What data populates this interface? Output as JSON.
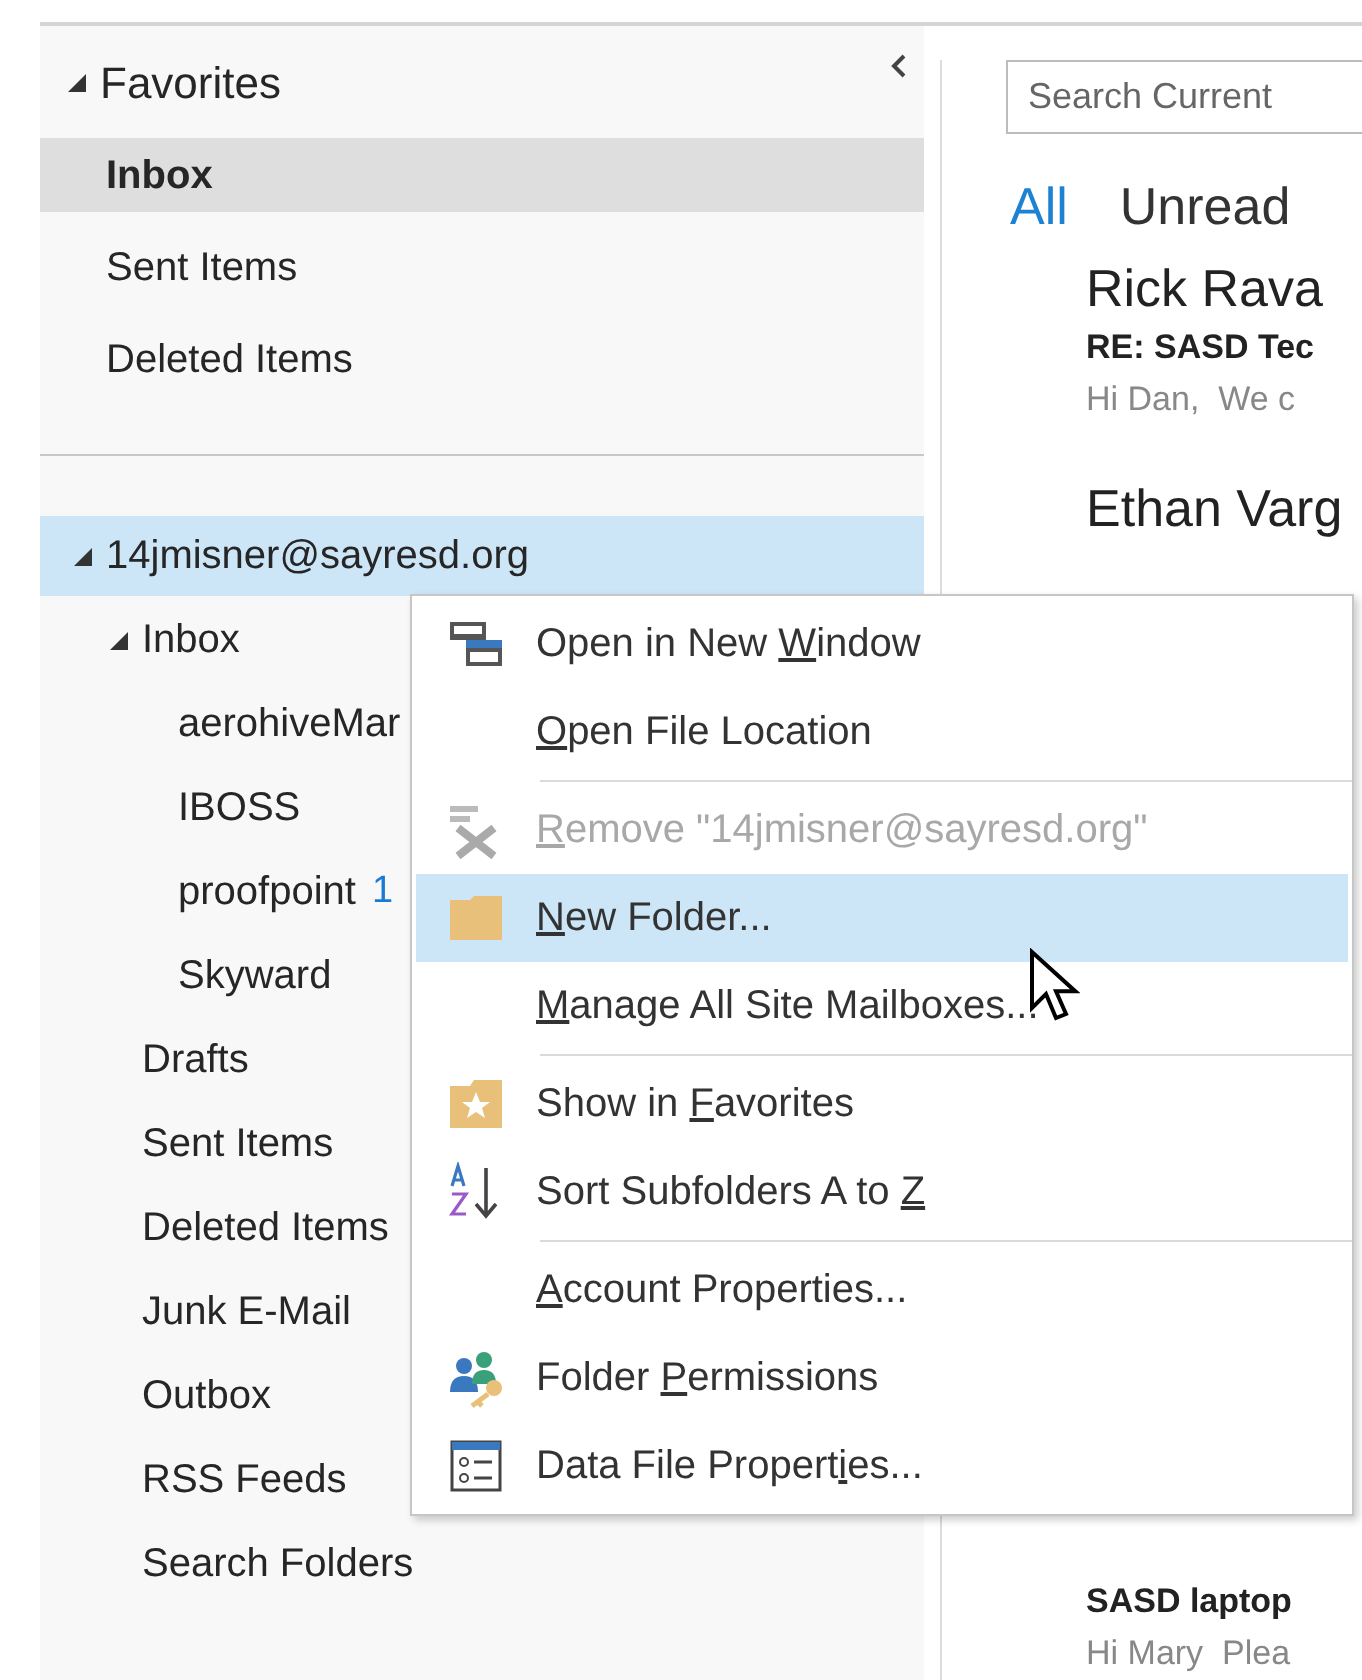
{
  "favorites": {
    "label": "Favorites",
    "expanded": true,
    "items": [
      {
        "label": "Inbox",
        "selected": true
      },
      {
        "label": "Sent Items",
        "selected": false
      },
      {
        "label": "Deleted Items",
        "selected": false
      }
    ]
  },
  "account": {
    "label": "14jmisner@sayresd.org",
    "expanded": true,
    "selected": true,
    "children": [
      {
        "label": "Inbox",
        "expanded": true,
        "selected": false,
        "children": [
          {
            "label": "aerohiveMar",
            "selected": false
          },
          {
            "label": "IBOSS",
            "selected": false
          },
          {
            "label": "proofpoint",
            "count": "1",
            "selected": false
          },
          {
            "label": "Skyward",
            "selected": false
          }
        ]
      },
      {
        "label": "Drafts",
        "selected": false
      },
      {
        "label": "Sent Items",
        "selected": false
      },
      {
        "label": "Deleted Items",
        "selected": false
      },
      {
        "label": "Junk E-Mail",
        "selected": false
      },
      {
        "label": "Outbox",
        "selected": false
      },
      {
        "label": "RSS Feeds",
        "selected": false
      },
      {
        "label": "Search Folders",
        "selected": false
      }
    ]
  },
  "search": {
    "placeholder": "Search Current"
  },
  "tabs": [
    {
      "label": "All",
      "selected": true
    },
    {
      "label": "Unread",
      "selected": false
    }
  ],
  "messages": [
    {
      "sender": "Rick Rava",
      "subject": "RE: SASD Tec",
      "preview": "Hi Dan,  We c"
    },
    {
      "sender": "Ethan Varg"
    },
    {
      "subject": "SASD laptop",
      "preview": "Hi Mary  Plea"
    }
  ],
  "context_menu": [
    {
      "kind": "item",
      "before": "Open in New ",
      "key": "W",
      "after": "indow",
      "disabled": false,
      "selected": false
    },
    {
      "kind": "item",
      "key": "O",
      "after": "pen File Location",
      "disabled": false,
      "selected": false
    },
    {
      "kind": "separator"
    },
    {
      "kind": "item",
      "key": "R",
      "after": "emove \"14jmisner@sayresd.org\"",
      "disabled": true,
      "selected": false
    },
    {
      "kind": "item",
      "key": "N",
      "after": "ew Folder...",
      "disabled": false,
      "selected": true
    },
    {
      "kind": "item",
      "key": "M",
      "after": "anage All Site Mailboxes...",
      "disabled": false,
      "selected": false
    },
    {
      "kind": "separator"
    },
    {
      "kind": "item",
      "before": "Show in ",
      "key": "F",
      "after": "avorites",
      "disabled": false,
      "selected": false
    },
    {
      "kind": "item",
      "before": "Sort Subfolders A to ",
      "key": "Z",
      "disabled": false,
      "selected": false
    },
    {
      "kind": "separator"
    },
    {
      "kind": "item",
      "key": "A",
      "after": "ccount Properties...",
      "disabled": false,
      "selected": false
    },
    {
      "kind": "item",
      "before": "Folder ",
      "key": "P",
      "after": "ermissions",
      "disabled": false,
      "selected": false
    },
    {
      "kind": "item",
      "before": "Data File Propert",
      "key": "i",
      "after": "es...",
      "disabled": false,
      "selected": false
    }
  ]
}
